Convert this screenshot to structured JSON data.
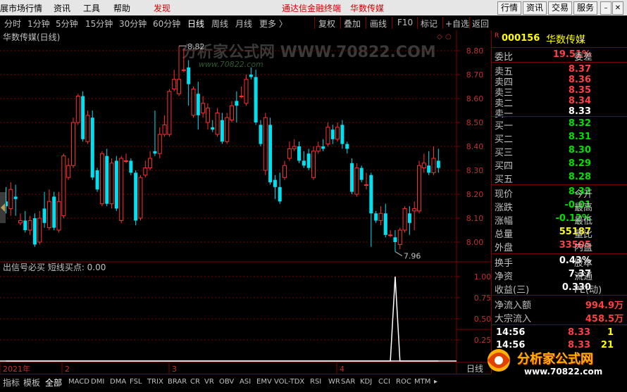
{
  "menubar": {
    "items": [
      "展市场行情",
      "资讯",
      "工具",
      "帮助",
      "发现"
    ],
    "center_title": "通达信金融终端",
    "center_stock": "华数传媒",
    "right_buttons": [
      "行情",
      "资讯",
      "交易",
      "服务"
    ]
  },
  "toolbar": {
    "periods": [
      "分时",
      "1分钟",
      "5分钟",
      "15分钟",
      "30分钟",
      "60分钟",
      "日线",
      "周线",
      "月线",
      "更多 〉"
    ],
    "active_period": "日线",
    "actions": [
      "复权",
      "叠加",
      "画线",
      "F10",
      "标记",
      "+自选",
      "返回"
    ]
  },
  "chart": {
    "title": "华数传媒(日线)",
    "watermark": "分析家公式网 WWW.70822.COM",
    "watermark_url": "www.70822.com",
    "high_label": "8.82",
    "low_label": "7.96",
    "price_ticks": [
      "8.80",
      "8.70",
      "8.60",
      "8.50",
      "8.40",
      "8.30",
      "8.20",
      "8.10",
      "8.00"
    ],
    "candles": [
      [
        8.17,
        8.15,
        8.23,
        8.12
      ],
      [
        8.14,
        8.22,
        8.25,
        8.11
      ],
      [
        8.19,
        8.18,
        8.24,
        8.11
      ],
      [
        8.08,
        8.09,
        8.12,
        8.07
      ],
      [
        8.09,
        8.05,
        8.13,
        8.04
      ],
      [
        8.05,
        8.09,
        8.11,
        8.03
      ],
      [
        8.1,
        7.99,
        8.12,
        7.98
      ],
      [
        8.0,
        8.1,
        8.13,
        7.99
      ],
      [
        8.14,
        8.08,
        8.21,
        8.06
      ],
      [
        8.06,
        8.17,
        8.22,
        8.05
      ],
      [
        8.19,
        8.06,
        8.21,
        8.05
      ],
      [
        8.05,
        8.17,
        8.21,
        8.04
      ],
      [
        8.11,
        8.36,
        8.37,
        8.1
      ],
      [
        8.27,
        8.32,
        8.35,
        8.26
      ],
      [
        8.32,
        8.5,
        8.52,
        8.31
      ],
      [
        8.5,
        8.61,
        8.62,
        8.49
      ],
      [
        8.61,
        8.43,
        8.63,
        8.42
      ],
      [
        8.42,
        8.53,
        8.55,
        8.41
      ],
      [
        8.52,
        8.27,
        8.55,
        8.26
      ],
      [
        8.3,
        8.22,
        8.31,
        8.21
      ],
      [
        8.16,
        8.37,
        8.38,
        8.15
      ],
      [
        8.36,
        8.16,
        8.39,
        8.15
      ],
      [
        8.16,
        8.33,
        8.35,
        8.14
      ],
      [
        8.34,
        8.14,
        8.36,
        8.13
      ],
      [
        8.09,
        8.35,
        8.36,
        8.08
      ],
      [
        8.34,
        8.34,
        8.37,
        8.33
      ],
      [
        8.34,
        8.29,
        8.35,
        8.28
      ],
      [
        8.29,
        8.09,
        8.3,
        8.07
      ],
      [
        8.1,
        8.27,
        8.28,
        8.09
      ],
      [
        8.28,
        8.31,
        8.34,
        8.27
      ],
      [
        8.31,
        8.35,
        8.38,
        8.3
      ],
      [
        8.38,
        8.37,
        8.55,
        8.36
      ],
      [
        8.37,
        8.45,
        8.48,
        8.35
      ],
      [
        8.45,
        8.49,
        8.53,
        8.44
      ],
      [
        8.45,
        8.63,
        8.64,
        8.44
      ],
      [
        8.64,
        8.68,
        8.72,
        8.63
      ],
      [
        8.62,
        8.68,
        8.82,
        8.61
      ],
      [
        8.72,
        8.72,
        8.81,
        8.71
      ],
      [
        8.73,
        8.66,
        8.76,
        8.57
      ],
      [
        8.53,
        8.64,
        8.65,
        8.52
      ],
      [
        8.62,
        8.53,
        8.67,
        8.47
      ],
      [
        8.54,
        8.58,
        8.61,
        8.52
      ],
      [
        8.5,
        8.56,
        8.58,
        8.47
      ],
      [
        8.48,
        8.47,
        8.51,
        8.46
      ],
      [
        8.45,
        8.54,
        8.56,
        8.44
      ],
      [
        8.51,
        8.42,
        8.54,
        8.41
      ],
      [
        8.42,
        8.52,
        8.54,
        8.41
      ],
      [
        8.51,
        8.57,
        8.59,
        8.5
      ],
      [
        8.59,
        8.57,
        8.63,
        8.5
      ],
      [
        8.61,
        8.61,
        8.65,
        8.6
      ],
      [
        8.58,
        8.68,
        8.7,
        8.57
      ],
      [
        8.7,
        8.69,
        8.73,
        8.68
      ],
      [
        8.69,
        8.5,
        8.72,
        8.49
      ],
      [
        8.49,
        8.41,
        8.51,
        8.4
      ],
      [
        8.3,
        8.52,
        8.54,
        8.28
      ],
      [
        8.49,
        8.25,
        8.52,
        8.24
      ],
      [
        8.26,
        8.23,
        8.28,
        8.18
      ],
      [
        8.23,
        8.17,
        8.29,
        8.16
      ],
      [
        8.27,
        8.32,
        8.34,
        8.26
      ],
      [
        8.35,
        8.39,
        8.42,
        8.34
      ],
      [
        8.39,
        8.4,
        8.43,
        8.38
      ],
      [
        8.4,
        8.34,
        8.42,
        8.33
      ],
      [
        8.34,
        8.32,
        8.38,
        8.31
      ],
      [
        8.37,
        8.31,
        8.39,
        8.3
      ],
      [
        8.27,
        8.38,
        8.4,
        8.26
      ],
      [
        8.38,
        8.4,
        8.42,
        8.37
      ],
      [
        8.4,
        8.39,
        8.43,
        8.38
      ],
      [
        8.41,
        8.48,
        8.5,
        8.4
      ],
      [
        8.47,
        8.43,
        8.49,
        8.41
      ],
      [
        8.43,
        8.48,
        8.5,
        8.42
      ],
      [
        8.49,
        8.41,
        8.51,
        8.39
      ],
      [
        8.41,
        8.39,
        8.42,
        8.37
      ],
      [
        8.33,
        8.21,
        8.35,
        8.2
      ],
      [
        8.2,
        8.31,
        8.33,
        8.19
      ],
      [
        8.31,
        8.26,
        8.32,
        8.25
      ],
      [
        8.24,
        8.24,
        8.29,
        8.22
      ],
      [
        8.28,
        8.12,
        8.29,
        7.98
      ],
      [
        8.12,
        8.09,
        8.13,
        8.08
      ],
      [
        8.09,
        8.12,
        8.15,
        8.07
      ],
      [
        8.12,
        8.03,
        8.16,
        8.02
      ],
      [
        8.03,
        8.03,
        8.05,
        8.02
      ],
      [
        8.02,
        8.0,
        8.05,
        7.96
      ],
      [
        7.99,
        8.05,
        8.06,
        7.97
      ],
      [
        8.05,
        8.14,
        8.15,
        8.04
      ],
      [
        8.12,
        8.08,
        8.15,
        8.03
      ],
      [
        8.13,
        8.14,
        8.17,
        8.05
      ],
      [
        8.13,
        8.32,
        8.34,
        8.12
      ],
      [
        8.31,
        8.33,
        8.37,
        8.29
      ],
      [
        8.32,
        8.29,
        8.38,
        8.28
      ],
      [
        8.29,
        8.35,
        8.4,
        8.28
      ],
      [
        8.34,
        8.31,
        8.39,
        8.29
      ]
    ],
    "indicator_label": "出信号必买  短线买点: 0.00",
    "indicator_ticks": [
      "1.00",
      "0.75",
      "0.50",
      "0.25"
    ],
    "date_labels": [
      "2021年",
      "2",
      "3",
      "4"
    ],
    "date_right": "日线",
    "colors": {
      "up": "#ff3030",
      "down": "#00e0f0",
      "grid": "#800000",
      "bg": "#000000"
    }
  },
  "panel": {
    "stock_code": "000156",
    "stock_name": "华数传媒",
    "code_marker": "R",
    "weibi_label": "委比",
    "weibi_value": "19.51%",
    "weicha_label": "委差",
    "sell": [
      {
        "label": "卖五",
        "price": "8.37"
      },
      {
        "label": "卖四",
        "price": "8.36"
      },
      {
        "label": "卖三",
        "price": "8.35"
      },
      {
        "label": "卖二",
        "price": "8.34"
      },
      {
        "label": "卖一",
        "price": "8.33"
      }
    ],
    "buy": [
      {
        "label": "买一",
        "price": "8.32"
      },
      {
        "label": "买二",
        "price": "8.31"
      },
      {
        "label": "买三",
        "price": "8.30"
      },
      {
        "label": "买四",
        "price": "8.29"
      },
      {
        "label": "买五",
        "price": "8.28"
      }
    ],
    "quote": [
      {
        "label": "现价",
        "value": "8.32",
        "color": "green",
        "label2": "今开"
      },
      {
        "label": "涨跌",
        "value": "-0.01",
        "color": "green",
        "label2": "最高"
      },
      {
        "label": "涨幅",
        "value": "-0.12%",
        "color": "green",
        "label2": "最低"
      },
      {
        "label": "总量",
        "value": "55187",
        "color": "yellow",
        "label2": "量比"
      },
      {
        "label": "外盘",
        "value": "33505",
        "color": "red",
        "label2": "内盘"
      }
    ],
    "fundamental": [
      {
        "label": "换手",
        "value": "0.43%",
        "label2": "股本"
      },
      {
        "label": "净资",
        "value": "7.37",
        "label2": "流通"
      },
      {
        "label": "收益(三)",
        "value": "0.330",
        "label2": "PE(动)"
      }
    ],
    "flow": [
      {
        "label": "净流入额",
        "value": "994.9万"
      },
      {
        "label": "大宗流入",
        "value": "458.5万"
      }
    ],
    "ticks": [
      {
        "time": "14:56",
        "price": "8.33",
        "vol": "1"
      },
      {
        "time": "14:56",
        "price": "8.33",
        "vol": "21"
      }
    ]
  },
  "bottombar": {
    "items": [
      "指标",
      "模板",
      "全部",
      "MACD",
      "DMI",
      "DMA",
      "FSL",
      "TRIX",
      "BRAR",
      "CR",
      "VR",
      "OBV",
      "ASI",
      "EMV",
      "VOL-TDX",
      "RSI",
      "WR",
      "SAR",
      "KDJ",
      "CCI",
      "ROC",
      "MTM"
    ],
    "active": "全部"
  },
  "logo": {
    "name": "分析家公式网",
    "url": "www.70822.com"
  }
}
